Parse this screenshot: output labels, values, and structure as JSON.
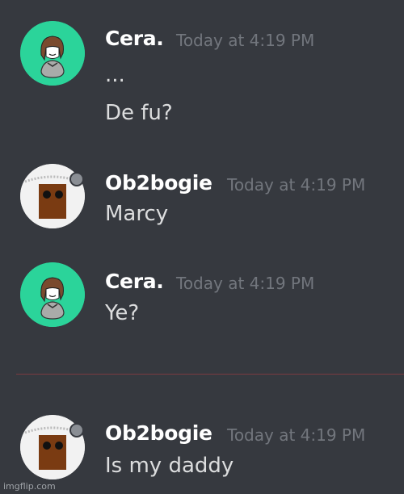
{
  "messages": [
    {
      "username": "Cera.",
      "timestamp": "Today at 4:19 PM",
      "lines": [
        "...",
        "De fu?"
      ],
      "avatar": "cera-avatar"
    },
    {
      "username": "Ob2bogie",
      "timestamp": "Today at 4:19 PM",
      "lines": [
        "Marcy"
      ],
      "avatar": "ob2bogie-avatar"
    },
    {
      "username": "Cera.",
      "timestamp": "Today at 4:19 PM",
      "lines": [
        "Ye?"
      ],
      "avatar": "cera-avatar"
    },
    {
      "username": "Ob2bogie",
      "timestamp": "Today at 4:19 PM",
      "lines": [
        "Is my daddy"
      ],
      "avatar": "ob2bogie-avatar"
    }
  ],
  "watermark": "imgflip.com",
  "colors": {
    "background": "#36393f",
    "username": "#ffffff",
    "timestamp": "#72767d",
    "message_text": "#dcddde",
    "cera_avatar_bg": "#2bd49a",
    "ob2bogie_avatar_bg": "#f2f2f2",
    "new_messages_divider": "#7a3a40"
  }
}
